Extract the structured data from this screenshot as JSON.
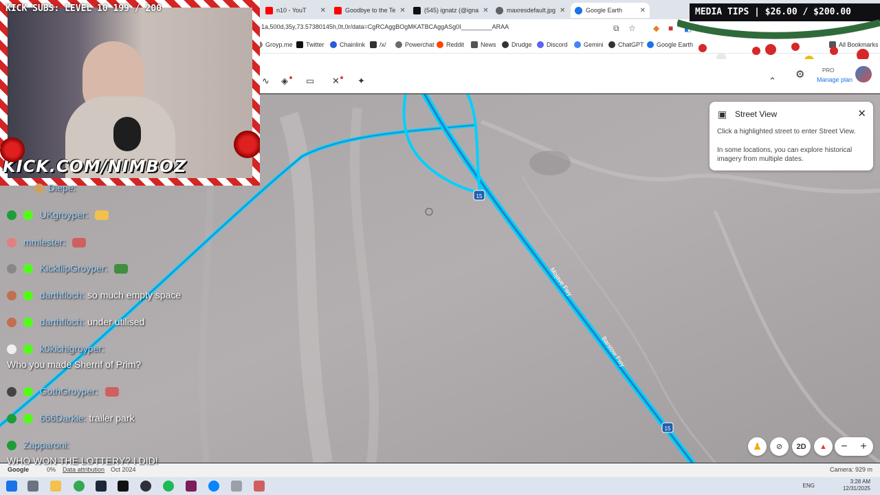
{
  "browser": {
    "tabs": [
      {
        "title": "n10 - YouT",
        "color": "#ff0000"
      },
      {
        "title": "Goodbye to the Te",
        "color": "#ff0000"
      },
      {
        "title": "(545) ignatz (@igna",
        "color": "#111111"
      },
      {
        "title": "maxresdefault.jpg",
        "color": "#5f6368"
      },
      {
        "title": "Google Earth",
        "color": "#1a73e8"
      }
    ],
    "url": "1a,500d,35y,73.57380145h,0t,0r/data=CgRCAggBOgMKATBCAggASg0I_________ARAA",
    "bookmarks": [
      {
        "label": "Groyp.me",
        "color": "#888888"
      },
      {
        "label": "Twitter",
        "color": "#111111"
      },
      {
        "label": "Chainlink",
        "color": "#2a5ada"
      },
      {
        "label": "/x/",
        "color": "#333333"
      },
      {
        "label": "Powerchat",
        "color": "#6a6a6a"
      },
      {
        "label": "Reddit",
        "color": "#ff4500"
      },
      {
        "label": "News",
        "color": "#555555"
      },
      {
        "label": "Drudge",
        "color": "#333333"
      },
      {
        "label": "Discord",
        "color": "#5865f2"
      },
      {
        "label": "Gemini",
        "color": "#4285f4"
      },
      {
        "label": "ChatGPT",
        "color": "#333333"
      },
      {
        "label": "Google Earth",
        "color": "#1a73e8"
      },
      {
        "label": "All Bookmarks",
        "color": "#555555"
      }
    ]
  },
  "earth": {
    "plan_badge": "PRO",
    "manage_plan": "Manage plan",
    "street_view": {
      "title": "Street View",
      "line1": "Click a highlighted street to enter Street View.",
      "line2": "In some locations, you can explore historical imagery from multiple dates."
    },
    "road_labels": [
      "Mojave Fwy",
      "Barstow Fwy"
    ],
    "shields": [
      "15",
      "15"
    ],
    "controls": {
      "mode_label": "2D",
      "zoom_out": "−",
      "zoom_in": "+"
    },
    "status": {
      "google": "Google",
      "percent": "0%",
      "attribution": "Data attribution",
      "date": "Oct 2024",
      "camera": "Camera: 929 m"
    }
  },
  "taskbar": {
    "time": "3:28 AM",
    "date": "12/31/2025",
    "lang": "ENG"
  },
  "stream": {
    "kick_subs": "KICK SUBS: LEVEL 10 199 / 200",
    "kick_url": "KICK.COM/NIMBOZ",
    "media_tips": "MEDIA TIPS | $26.00 / $200.00"
  },
  "chat": [
    {
      "name": "Diepe:",
      "msg": "",
      "badge": "#d0a060"
    },
    {
      "name": "UKgroyper:",
      "msg": "",
      "badge": "#1d9d3a"
    },
    {
      "name": "mmlester:",
      "msg": "",
      "badge": "#e08080"
    },
    {
      "name": "KickflipGroyper:",
      "msg": "",
      "badge": "#888888"
    },
    {
      "name": "darthfloch:",
      "msg": "so much empty space",
      "badge": "#c07050"
    },
    {
      "name": "darthfloch:",
      "msg": "under utilised",
      "badge": "#c07050"
    },
    {
      "name": "k0kichigroyper:",
      "msg": "",
      "badge": "#f0f0f0"
    },
    {
      "name": "",
      "msg": "Who you made Sherrif of Prim?",
      "badge": ""
    },
    {
      "name": "GothGroyper:",
      "msg": "",
      "badge": "#444444"
    },
    {
      "name": "666Darkie:",
      "msg": "trailer park",
      "badge": "#1d9d3a"
    },
    {
      "name": "Zapparoni:",
      "msg": "",
      "badge": "#1d9d3a"
    },
    {
      "name": "",
      "msg": "WHO WON THE LOTTERY? I DID!",
      "badge": ""
    }
  ]
}
